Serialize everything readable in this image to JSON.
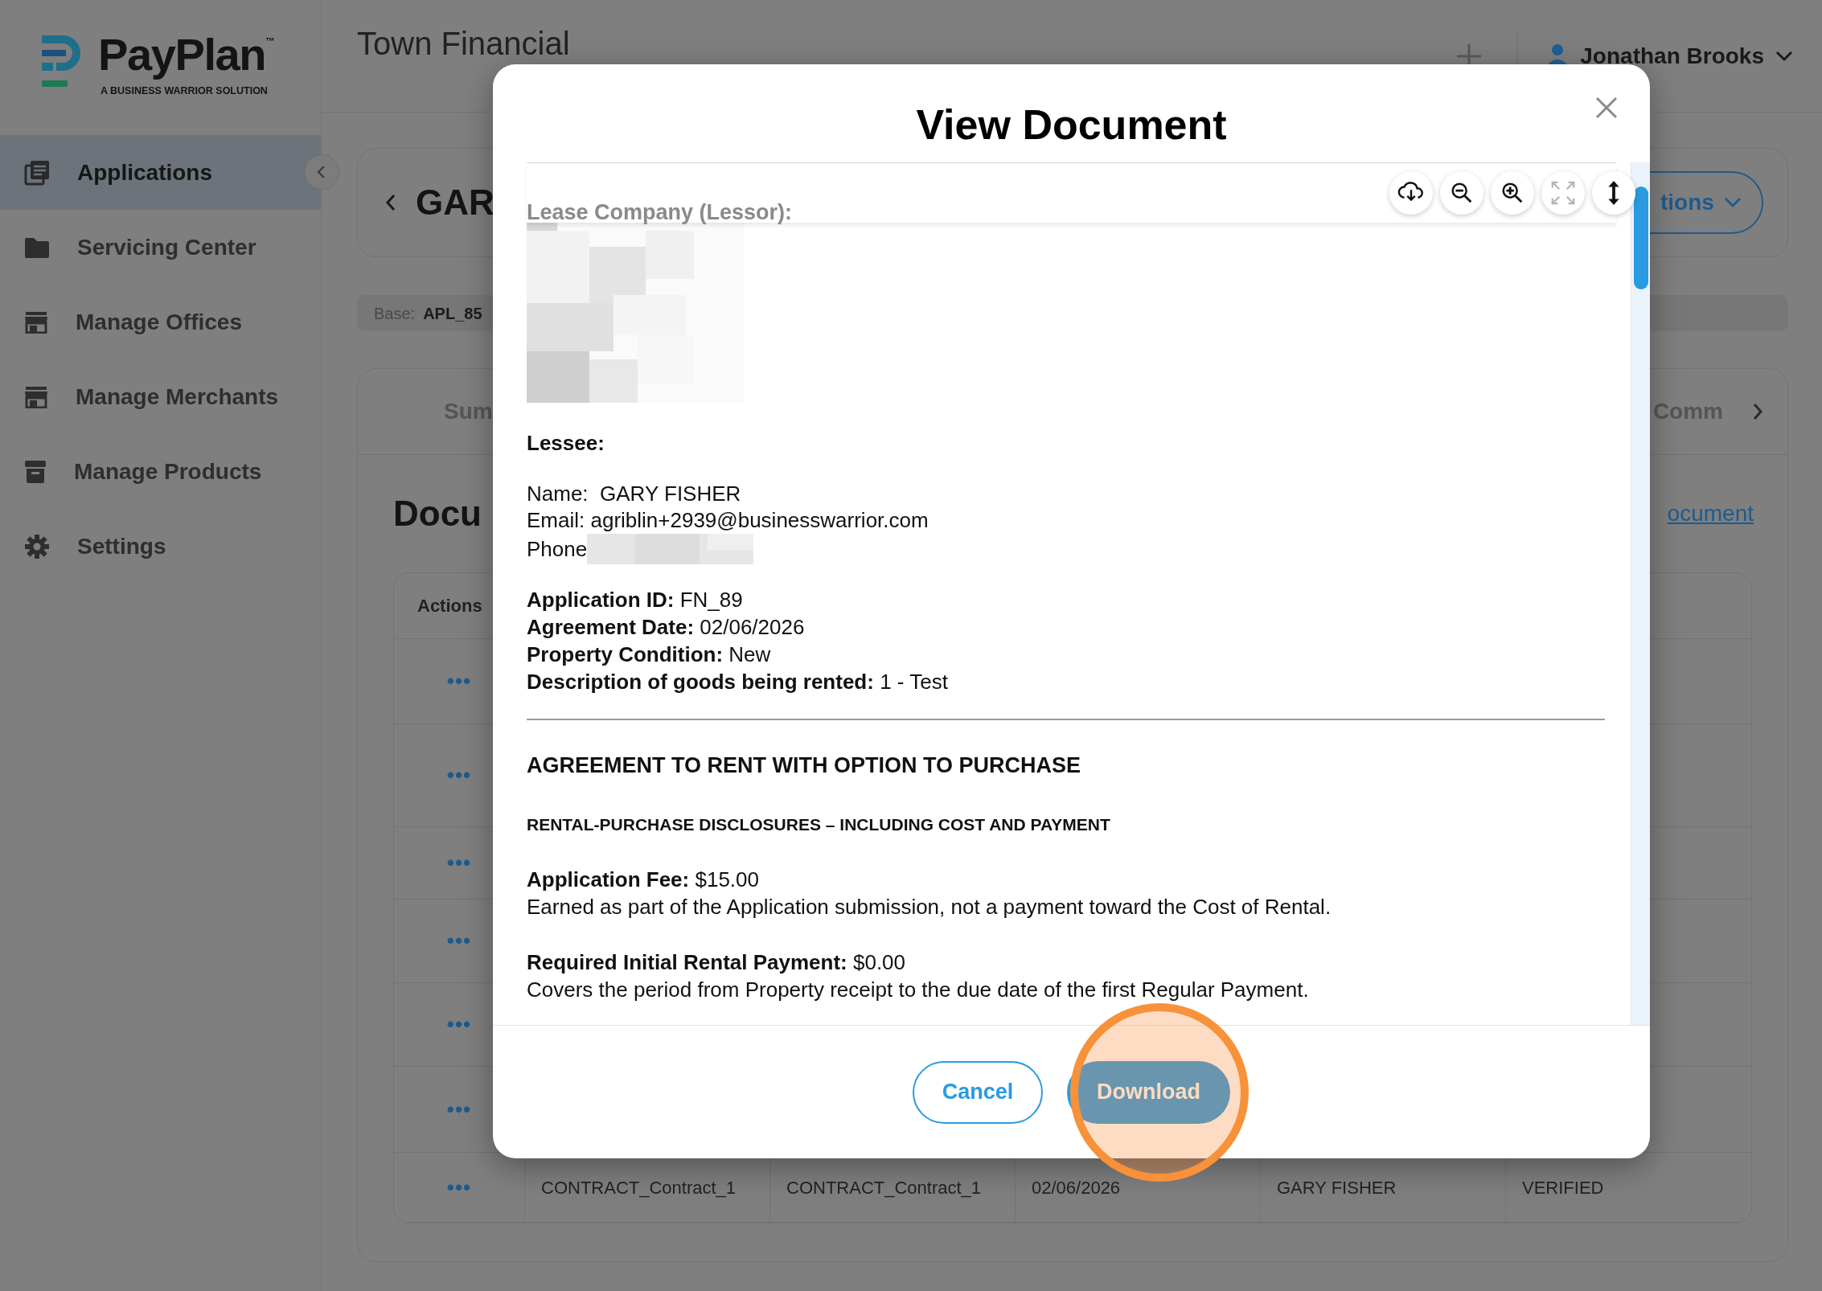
{
  "logo": {
    "name": "PayPlan",
    "trademark": "™",
    "tagline": "A BUSINESS WARRIOR SOLUTION"
  },
  "sidebar": {
    "items": [
      {
        "label": "Applications",
        "selected": true
      },
      {
        "label": "Servicing Center",
        "selected": false
      },
      {
        "label": "Manage Offices",
        "selected": false
      },
      {
        "label": "Manage Merchants",
        "selected": false
      },
      {
        "label": "Manage Products",
        "selected": false
      },
      {
        "label": "Settings",
        "selected": false
      }
    ]
  },
  "header": {
    "title": "Town Financial",
    "user": "Jonathan Brooks"
  },
  "page": {
    "applicant": "GAR",
    "actions_button": "tions",
    "base_label": "Base:",
    "base_value": "APL_85",
    "tab_left": "Sum",
    "tab_right": "Comm",
    "section_title": "Docu",
    "document_link": "ocument",
    "table": {
      "header": "Actions",
      "rows": [
        {
          "actions": "•••"
        },
        {
          "actions": "•••"
        },
        {
          "actions": "•••"
        },
        {
          "actions": "•••"
        },
        {
          "actions": "•••"
        },
        {
          "actions": "•••"
        },
        {
          "actions": "•••",
          "cells": [
            "CONTRACT_Contract_1",
            "CONTRACT_Contract_1",
            "02/06/2026",
            "GARY FISHER",
            "VERIFIED"
          ]
        }
      ]
    }
  },
  "modal": {
    "title": "View Document",
    "toolbar": [
      {
        "disabled": false
      },
      {
        "disabled": false
      },
      {
        "disabled": false
      },
      {
        "disabled": true
      },
      {
        "disabled": false
      }
    ],
    "document": {
      "lessor_label": "Lease Company (Lessor):",
      "lessee_heading": "Lessee:",
      "name_line": "Name:  GARY FISHER",
      "email_line": "Email: agriblin+2939@businesswarrior.com",
      "phone_label": "Phone",
      "details": [
        "**Application ID:** FN_89",
        "**Agreement Date:** 02/06/2026",
        "**Property Condition:** New",
        "**Description of goods being rented:** 1 - Test"
      ],
      "heading": "AGREEMENT TO RENT WITH OPTION TO PURCHASE",
      "subheading": "RENTAL-PURCHASE DISCLOSURES – INCLUDING COST AND PAYMENT",
      "terms": [
        {
          "title": "**Application Fee:** $15.00",
          "text": "Earned as part of the Application submission, not a payment toward the Cost of Rental."
        },
        {
          "title": "**Required Initial Rental Payment:** $0.00",
          "text": "Covers the period from Property receipt to the due date of the first Regular Payment."
        }
      ]
    },
    "buttons": [
      {
        "label": "Cancel",
        "kind": "outline"
      },
      {
        "label": "Download",
        "kind": "primary"
      }
    ]
  }
}
